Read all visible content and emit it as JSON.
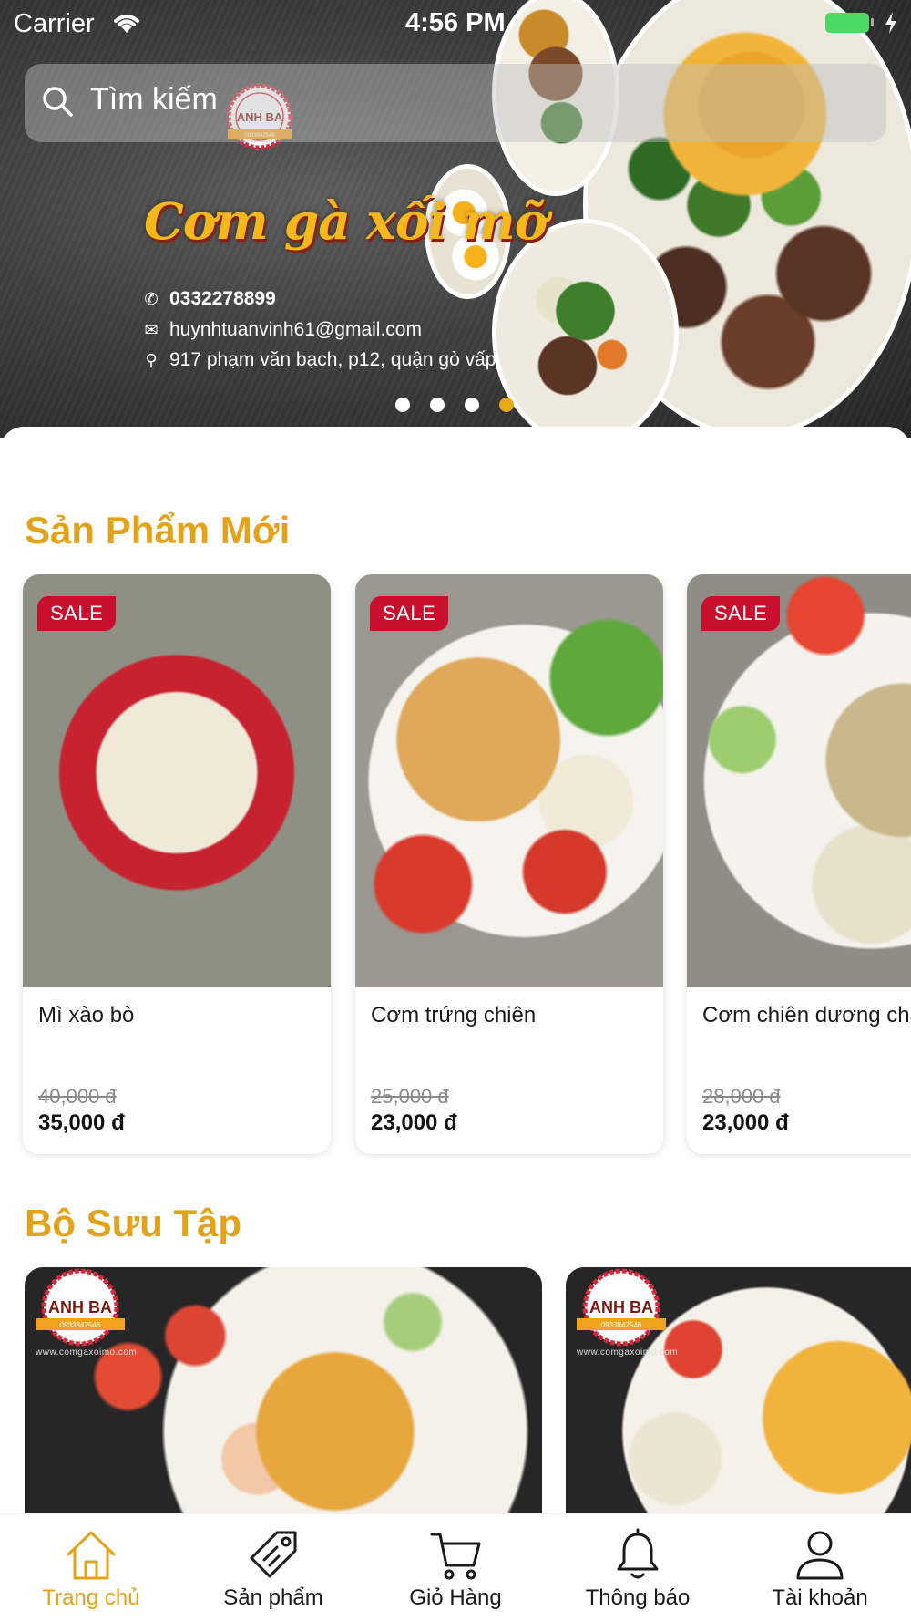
{
  "status_bar": {
    "carrier": "Carrier",
    "time": "4:56 PM"
  },
  "search": {
    "placeholder": "Tìm kiếm"
  },
  "banner": {
    "logo_text": "ANH BA",
    "logo_phone": "0933842546",
    "title": "Cơm gà xối mỡ",
    "phone": "0332278899",
    "email": "huynhtuanvinh61@gmail.com",
    "address": "917 phạm văn bạch, p12, quận gò vấp",
    "slides_total": 4,
    "active_slide": 4
  },
  "sections": {
    "new_products": "Sản Phẩm Mới",
    "collections": "Bộ Sưu Tập"
  },
  "products": [
    {
      "badge": "SALE",
      "name": "Mì xào bò",
      "old_price": "40,000 đ",
      "price": "35,000 đ"
    },
    {
      "badge": "SALE",
      "name": "Cơm trứng chiên",
      "old_price": "25,000 đ",
      "price": "23,000 đ"
    },
    {
      "badge": "SALE",
      "name": "Cơm chiên dương châu",
      "old_price": "28,000 đ",
      "price": "23,000 đ"
    }
  ],
  "collections": [
    {
      "logo_text": "ANH BA",
      "logo_phone": "0933842546",
      "url": "www.comgaxoimo.com"
    },
    {
      "logo_text": "ANH BA",
      "logo_phone": "0933842546",
      "url": "www.comgaxoimo.com"
    }
  ],
  "tabbar": {
    "active": "home",
    "items": [
      {
        "id": "home",
        "label": "Trang chủ",
        "icon": "home-icon"
      },
      {
        "id": "products",
        "label": "Sản phẩm",
        "icon": "tag-icon"
      },
      {
        "id": "cart",
        "label": "Giỏ Hàng",
        "icon": "cart-icon"
      },
      {
        "id": "notifications",
        "label": "Thông báo",
        "icon": "bell-icon"
      },
      {
        "id": "account",
        "label": "Tài khoản",
        "icon": "user-icon"
      }
    ]
  },
  "colors": {
    "accent": "#E3A21A",
    "sale": "#C8102E",
    "battery": "#4CD964"
  }
}
